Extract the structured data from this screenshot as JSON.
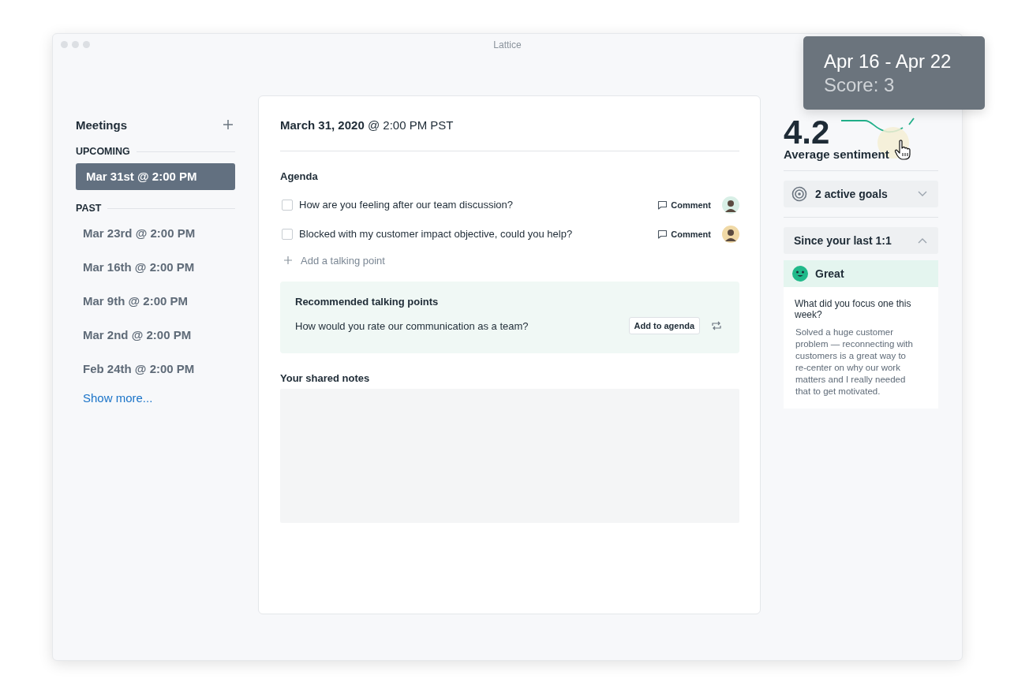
{
  "window": {
    "title": "Lattice"
  },
  "sidebar": {
    "title": "Meetings",
    "sections": [
      {
        "label": "UPCOMING",
        "items": [
          {
            "label": "Mar 31st @ 2:00 PM",
            "selected": true
          }
        ]
      },
      {
        "label": "PAST",
        "items": [
          {
            "label": "Mar 23rd @ 2:00 PM",
            "selected": false
          },
          {
            "label": "Mar 16th @ 2:00 PM",
            "selected": false
          },
          {
            "label": "Mar 9th @ 2:00 PM",
            "selected": false
          },
          {
            "label": "Mar 2nd @ 2:00 PM",
            "selected": false
          },
          {
            "label": "Feb 24th @ 2:00 PM",
            "selected": false
          }
        ]
      }
    ],
    "show_more": "Show more..."
  },
  "meeting": {
    "title": "**March 31, 2020** @ 2:00 PM PST",
    "agenda": {
      "heading": "Agenda",
      "items": [
        {
          "text": "How are you feeling after our team discussion?",
          "checked": false,
          "comment": "Comment"
        },
        {
          "text": "Blocked with my customer impact objective, could you help?",
          "checked": false,
          "comment": "Comment"
        }
      ],
      "add": "Add a talking point"
    },
    "recommended": {
      "heading": "Recommended talking points",
      "items": [
        {
          "text": "How would you rate our communication as a team?",
          "button": "Add to agenda"
        }
      ]
    },
    "notes": {
      "heading": "Your shared notes"
    }
  },
  "sentiment": {
    "score": "4.2",
    "label": "Average sentiment",
    "tooltip": {
      "range": "Apr 16 - Apr 22",
      "score": "Score: 3"
    }
  },
  "goals": {
    "label": "2 active goals",
    "expanded": false
  },
  "since": {
    "title": "Since your last 1:1",
    "expanded": true,
    "mood": "Great",
    "question": "What did you focus one this week?",
    "answer": "Solved a huge customer problem — reconnecting with customers is a great way to re-center on why our work matters and I really needed that to get motivated."
  }
}
